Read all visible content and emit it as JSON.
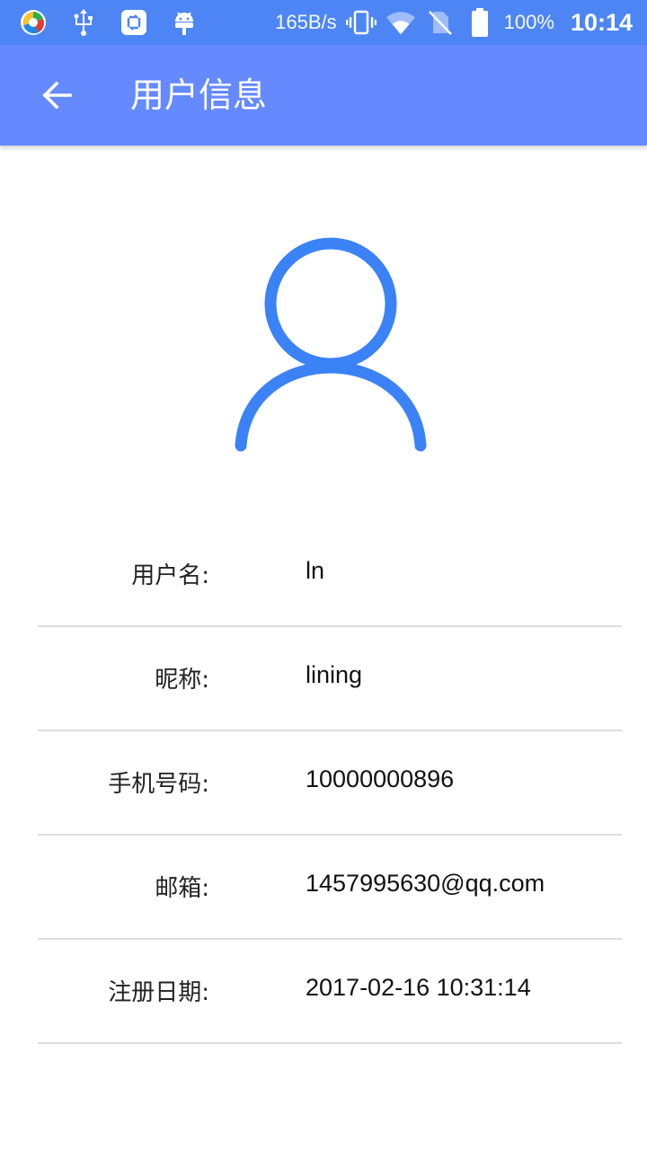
{
  "status_bar": {
    "net_speed": "165B/s",
    "battery": "100%",
    "time": "10:14",
    "icons": [
      "app-icon",
      "usb-icon",
      "sync-icon",
      "android-debug-icon",
      "vibrate-icon",
      "wifi-icon",
      "no-sim-icon",
      "battery-icon"
    ]
  },
  "app_bar": {
    "title": "用户信息",
    "back_icon": "arrow-left-icon"
  },
  "avatar": {
    "icon": "user-outline-icon",
    "color": "#3b82f6"
  },
  "info": [
    {
      "label": "用户名:",
      "value": "ln"
    },
    {
      "label": "昵称:",
      "value": "lining"
    },
    {
      "label": "手机号码:",
      "value": "10000000896"
    },
    {
      "label": "邮箱:",
      "value": "1457995630@qq.com"
    },
    {
      "label": "注册日期:",
      "value": "2017-02-16 10:31:14"
    }
  ],
  "colors": {
    "status_bar": "#4d86f4",
    "app_bar": "#6589ff",
    "accent": "#3b82f6",
    "divider": "#dddddd"
  }
}
